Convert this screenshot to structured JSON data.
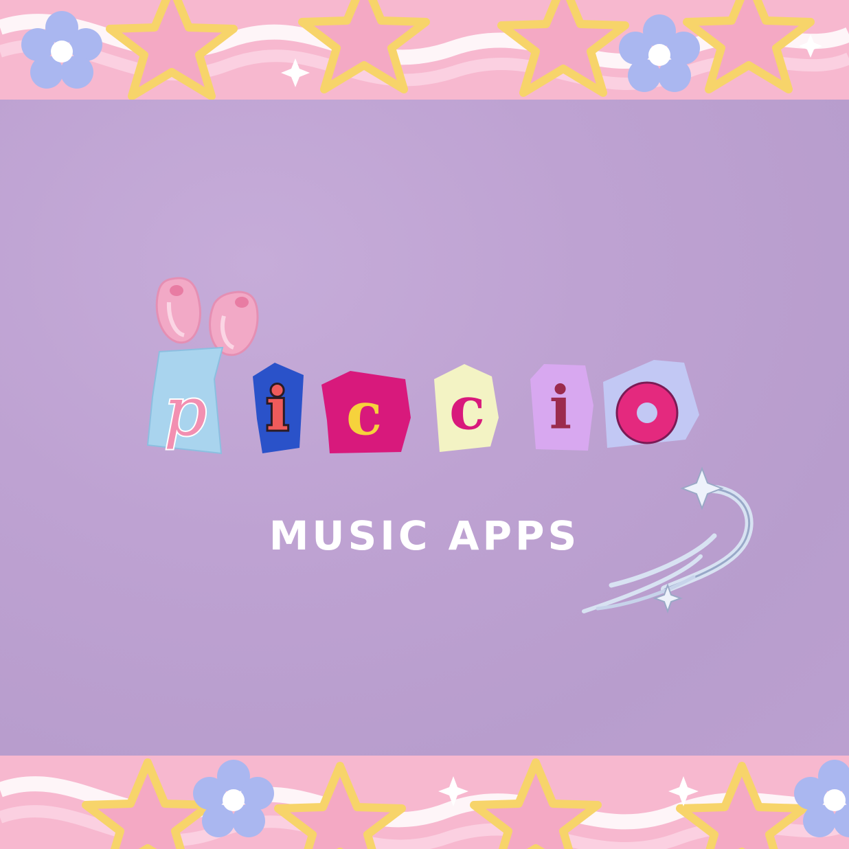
{
  "brand": {
    "letters": [
      "p",
      "i",
      "c",
      "c",
      "i",
      "o"
    ],
    "subtitle": "MUSIC APPS"
  },
  "colors": {
    "background": "#bfa3d3",
    "band_pink": "#f7b8cf",
    "star_pink": "#f4a9c4",
    "star_yellow": "#f7d46a",
    "flower_blue": "#aab7f0",
    "tile_blue": "#a9d4ee",
    "tile_navy": "#2a52c9",
    "tile_magenta": "#d8197c",
    "tile_cream": "#f3f3c4",
    "tile_lavender": "#d8a8f0",
    "tile_periwinkle": "#c2c8f4",
    "letter_salmon": "#ef5b5b",
    "letter_yellow": "#f6d23c",
    "letter_maroon": "#9b2b4d",
    "letter_pink": "#e4297e"
  },
  "icons": {
    "ears": "bunny-ears-icon",
    "star": "shooting-star-icon"
  }
}
